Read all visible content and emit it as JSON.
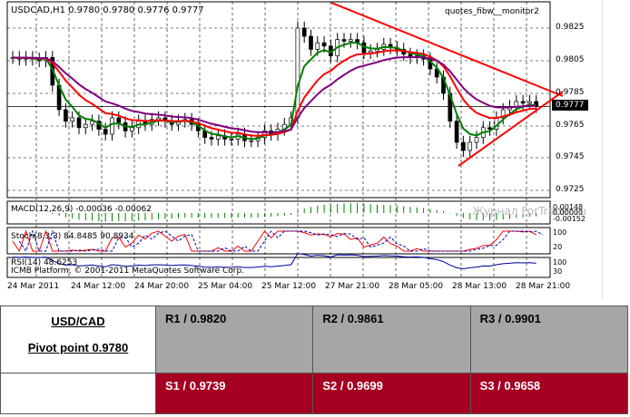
{
  "chart": {
    "title": "USDCAD,H1  0.9780 0.9780 0.9776 0.9777",
    "expert": "quotes_fibw__monitor2",
    "price_labels": [
      "0.9825",
      "0.9805",
      "0.9785",
      "0.9765",
      "0.9745",
      "0.9725"
    ],
    "current_price": "0.9777",
    "macd_label": "MACD(12,26,9) -0.00036 -0.00062",
    "macd_scale": [
      "0.00148",
      "0.00000",
      "-0.00152"
    ],
    "watermark": "Журнал ForTrader.ru",
    "stoch_label": "Stoch(8,3,3) 84.8485 90.8934",
    "stoch_scale": [
      "100",
      "80",
      "20",
      "0"
    ],
    "rsi_label": "RSI(14) 48.6253",
    "rsi_scale": [
      "100",
      "70",
      "30",
      "0"
    ],
    "copyright": "ICMB Platform, © 2001-2011 MetaQuotes Software Corp.",
    "time_labels": [
      "24 Mar 2011",
      "24 Mar 12:00",
      "24 Mar 20:00",
      "25 Mar 04:00",
      "25 Mar 12:00",
      "27 Mar 21:00",
      "28 Mar 05:00",
      "28 Mar 13:00",
      "28 Mar 21:00"
    ],
    "colors": {
      "trend": "#ff0000",
      "ma_fast": "#008000",
      "ma_mid": "#ff0000",
      "ma_slow": "#800080",
      "rsi": "#0000a0"
    }
  },
  "chart_data": {
    "type": "candlestick",
    "closes": [
      0.9807,
      0.9806,
      0.9807,
      0.9806,
      0.9805,
      0.9807,
      0.979,
      0.9775,
      0.9768,
      0.977,
      0.9764,
      0.9766,
      0.9768,
      0.9763,
      0.976,
      0.977,
      0.9767,
      0.9762,
      0.9764,
      0.9768,
      0.9766,
      0.9769,
      0.977,
      0.9768,
      0.9766,
      0.9768,
      0.9769,
      0.9766,
      0.9762,
      0.9758,
      0.9757,
      0.9759,
      0.9757,
      0.9757,
      0.976,
      0.9756,
      0.9756,
      0.9758,
      0.9762,
      0.976,
      0.9763,
      0.9766,
      0.977,
      0.9825,
      0.982,
      0.9812,
      0.9816,
      0.9814,
      0.9808,
      0.9818,
      0.9817,
      0.9818,
      0.9816,
      0.981,
      0.9811,
      0.9812,
      0.9815,
      0.9813,
      0.9812,
      0.9809,
      0.9807,
      0.9808,
      0.9806,
      0.98,
      0.9795,
      0.9785,
      0.9768,
      0.9755,
      0.975,
      0.9755,
      0.9758,
      0.9764,
      0.9763,
      0.977,
      0.9775,
      0.9777,
      0.978,
      0.9779,
      0.978,
      0.9777
    ],
    "ylim": [
      0.9715,
      0.9842
    ]
  },
  "pivot": {
    "symbol": "USD/CAD",
    "pivot": "Pivot point 0.9780",
    "r": [
      "R1 / 0.9820",
      "R2 / 0.9861",
      "R3 / 0.9901"
    ],
    "s": [
      "S1 / 0.9739",
      "S2 / 0.9699",
      "S3 / 0.9658"
    ]
  }
}
